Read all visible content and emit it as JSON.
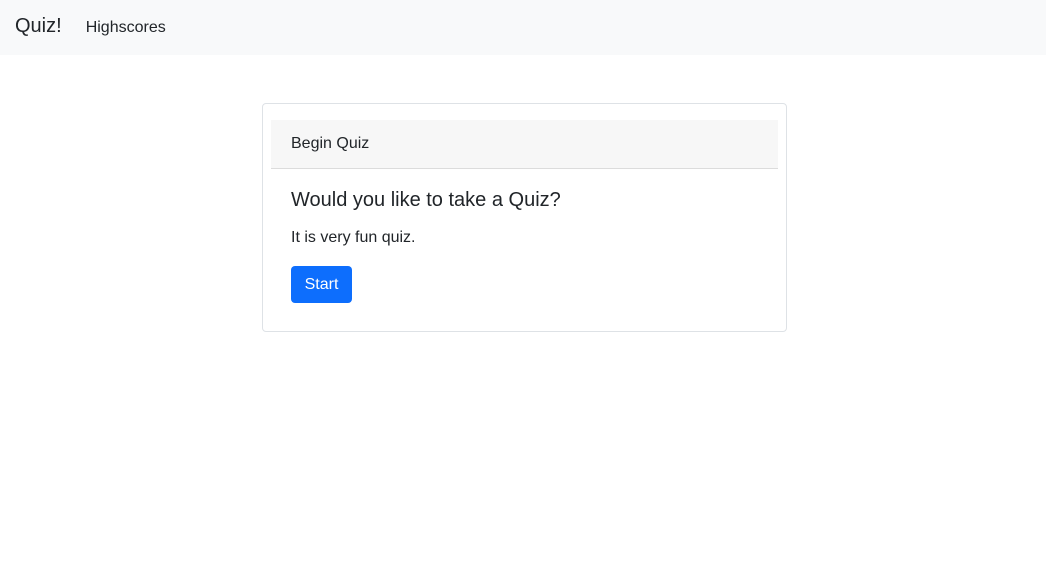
{
  "navbar": {
    "brand": "Quiz!",
    "links": [
      {
        "label": "Highscores"
      }
    ]
  },
  "card": {
    "header": "Begin Quiz",
    "title": "Would you like to take a Quiz?",
    "text": "It is very fun quiz.",
    "start_label": "Start"
  },
  "colors": {
    "navbar_bg": "#f8f9fa",
    "primary": "#0d6efd",
    "text": "#212529"
  }
}
